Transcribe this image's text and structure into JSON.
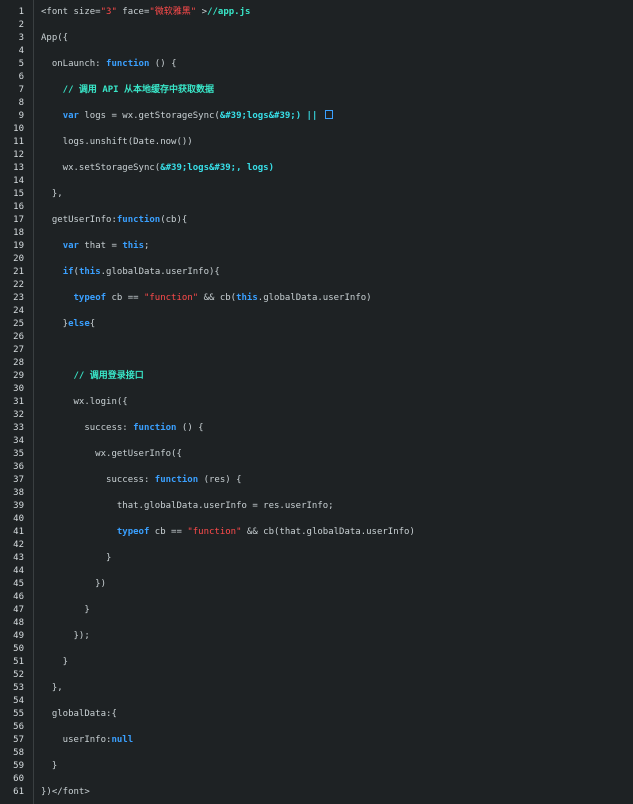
{
  "editor": {
    "lines": [
      {
        "n": "1",
        "tokens": [
          {
            "t": "<font size=",
            "c": "plain"
          },
          {
            "t": "\"3\"",
            "c": "str"
          },
          {
            "t": " face=",
            "c": "plain"
          },
          {
            "t": "\"微软雅黑\"",
            "c": "str"
          },
          {
            "t": " >",
            "c": "plain"
          },
          {
            "t": "//app.js",
            "c": "cmt"
          }
        ]
      },
      {
        "n": "2",
        "tokens": []
      },
      {
        "n": "3",
        "tokens": [
          {
            "t": "App({",
            "c": "plain"
          }
        ]
      },
      {
        "n": "4",
        "tokens": []
      },
      {
        "n": "5",
        "tokens": [
          {
            "t": "  onLaunch: ",
            "c": "plain"
          },
          {
            "t": "function",
            "c": "kw"
          },
          {
            "t": " () {",
            "c": "plain"
          }
        ]
      },
      {
        "n": "6",
        "tokens": []
      },
      {
        "n": "7",
        "tokens": [
          {
            "t": "    // 调用 API 从本地缓存中获取数据",
            "c": "cmt"
          }
        ]
      },
      {
        "n": "8",
        "tokens": []
      },
      {
        "n": "9",
        "tokens": [
          {
            "t": "    ",
            "c": "plain"
          },
          {
            "t": "var",
            "c": "kw"
          },
          {
            "t": " logs = wx.getStorageSync(",
            "c": "plain"
          },
          {
            "t": "&#39;logs&#39;) || ",
            "c": "ent"
          },
          {
            "t": "[]",
            "c": "box"
          }
        ]
      },
      {
        "n": "10",
        "tokens": []
      },
      {
        "n": "11",
        "tokens": [
          {
            "t": "    logs.unshift(Date.now())",
            "c": "plain"
          }
        ]
      },
      {
        "n": "12",
        "tokens": []
      },
      {
        "n": "13",
        "tokens": [
          {
            "t": "    wx.setStorageSync(",
            "c": "plain"
          },
          {
            "t": "&#39;logs&#39;, logs)",
            "c": "ent"
          }
        ]
      },
      {
        "n": "14",
        "tokens": []
      },
      {
        "n": "15",
        "tokens": [
          {
            "t": "  },",
            "c": "plain"
          }
        ]
      },
      {
        "n": "16",
        "tokens": []
      },
      {
        "n": "17",
        "tokens": [
          {
            "t": "  getUserInfo:",
            "c": "plain"
          },
          {
            "t": "function",
            "c": "kw"
          },
          {
            "t": "(cb){",
            "c": "plain"
          }
        ]
      },
      {
        "n": "18",
        "tokens": []
      },
      {
        "n": "19",
        "tokens": [
          {
            "t": "    ",
            "c": "plain"
          },
          {
            "t": "var",
            "c": "kw"
          },
          {
            "t": " that = ",
            "c": "plain"
          },
          {
            "t": "this",
            "c": "kw"
          },
          {
            "t": ";",
            "c": "plain"
          }
        ]
      },
      {
        "n": "20",
        "tokens": []
      },
      {
        "n": "21",
        "tokens": [
          {
            "t": "    ",
            "c": "plain"
          },
          {
            "t": "if",
            "c": "kw"
          },
          {
            "t": "(",
            "c": "plain"
          },
          {
            "t": "this",
            "c": "kw"
          },
          {
            "t": ".globalData.userInfo){",
            "c": "plain"
          }
        ]
      },
      {
        "n": "22",
        "tokens": []
      },
      {
        "n": "23",
        "tokens": [
          {
            "t": "      ",
            "c": "plain"
          },
          {
            "t": "typeof",
            "c": "kw"
          },
          {
            "t": " cb == ",
            "c": "plain"
          },
          {
            "t": "\"function\"",
            "c": "str"
          },
          {
            "t": " && cb(",
            "c": "plain"
          },
          {
            "t": "this",
            "c": "kw"
          },
          {
            "t": ".globalData.userInfo)",
            "c": "plain"
          }
        ]
      },
      {
        "n": "24",
        "tokens": []
      },
      {
        "n": "25",
        "tokens": [
          {
            "t": "    }",
            "c": "plain"
          },
          {
            "t": "else",
            "c": "kw"
          },
          {
            "t": "{",
            "c": "plain"
          }
        ]
      },
      {
        "n": "26",
        "tokens": []
      },
      {
        "n": "27",
        "tokens": []
      },
      {
        "n": "28",
        "tokens": []
      },
      {
        "n": "29",
        "tokens": [
          {
            "t": "      // 调用登录接口",
            "c": "cmt"
          }
        ]
      },
      {
        "n": "30",
        "tokens": []
      },
      {
        "n": "31",
        "tokens": [
          {
            "t": "      wx.login({",
            "c": "plain"
          }
        ]
      },
      {
        "n": "32",
        "tokens": []
      },
      {
        "n": "33",
        "tokens": [
          {
            "t": "        success: ",
            "c": "plain"
          },
          {
            "t": "function",
            "c": "kw"
          },
          {
            "t": " () {",
            "c": "plain"
          }
        ]
      },
      {
        "n": "34",
        "tokens": []
      },
      {
        "n": "35",
        "tokens": [
          {
            "t": "          wx.getUserInfo({",
            "c": "plain"
          }
        ]
      },
      {
        "n": "36",
        "tokens": []
      },
      {
        "n": "37",
        "tokens": [
          {
            "t": "            success: ",
            "c": "plain"
          },
          {
            "t": "function",
            "c": "kw"
          },
          {
            "t": " (res) {",
            "c": "plain"
          }
        ]
      },
      {
        "n": "38",
        "tokens": []
      },
      {
        "n": "39",
        "tokens": [
          {
            "t": "              that.globalData.userInfo = res.userInfo;",
            "c": "plain"
          }
        ]
      },
      {
        "n": "40",
        "tokens": []
      },
      {
        "n": "41",
        "tokens": [
          {
            "t": "              ",
            "c": "plain"
          },
          {
            "t": "typeof",
            "c": "kw"
          },
          {
            "t": " cb == ",
            "c": "plain"
          },
          {
            "t": "\"function\"",
            "c": "str"
          },
          {
            "t": " && cb(that.globalData.userInfo)",
            "c": "plain"
          }
        ]
      },
      {
        "n": "42",
        "tokens": []
      },
      {
        "n": "43",
        "tokens": [
          {
            "t": "            }",
            "c": "plain"
          }
        ]
      },
      {
        "n": "44",
        "tokens": []
      },
      {
        "n": "45",
        "tokens": [
          {
            "t": "          })",
            "c": "plain"
          }
        ]
      },
      {
        "n": "46",
        "tokens": []
      },
      {
        "n": "47",
        "tokens": [
          {
            "t": "        }",
            "c": "plain"
          }
        ]
      },
      {
        "n": "48",
        "tokens": []
      },
      {
        "n": "49",
        "tokens": [
          {
            "t": "      });",
            "c": "plain"
          }
        ]
      },
      {
        "n": "50",
        "tokens": []
      },
      {
        "n": "51",
        "tokens": [
          {
            "t": "    }",
            "c": "plain"
          }
        ]
      },
      {
        "n": "52",
        "tokens": []
      },
      {
        "n": "53",
        "tokens": [
          {
            "t": "  },",
            "c": "plain"
          }
        ]
      },
      {
        "n": "54",
        "tokens": []
      },
      {
        "n": "55",
        "tokens": [
          {
            "t": "  globalData:{",
            "c": "plain"
          }
        ]
      },
      {
        "n": "56",
        "tokens": []
      },
      {
        "n": "57",
        "tokens": [
          {
            "t": "    userInfo:",
            "c": "plain"
          },
          {
            "t": "null",
            "c": "kw"
          }
        ]
      },
      {
        "n": "58",
        "tokens": []
      },
      {
        "n": "59",
        "tokens": [
          {
            "t": "  }",
            "c": "plain"
          }
        ]
      },
      {
        "n": "60",
        "tokens": []
      },
      {
        "n": "61",
        "tokens": [
          {
            "t": "})</font>",
            "c": "plain"
          }
        ]
      }
    ]
  },
  "colors": {
    "background": "#1e2224",
    "keyword": "#3aa0ff",
    "string": "#ff4b4b",
    "comment": "#39e6c8",
    "plain": "#c9d1d4"
  }
}
